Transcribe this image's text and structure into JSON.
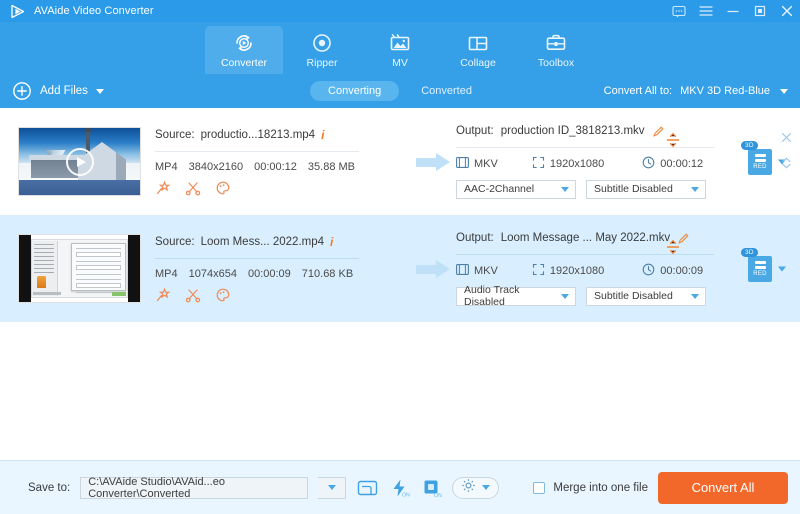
{
  "app": {
    "title": "AVAide Video Converter",
    "brand_color": "#2b9ae8",
    "accent_color": "#f2682a"
  },
  "titlebar": {
    "icons": [
      {
        "name": "feedback-icon",
        "glyph": "message"
      },
      {
        "name": "menu-icon",
        "glyph": "hamburger"
      },
      {
        "name": "minimize-icon",
        "glyph": "minimize"
      },
      {
        "name": "maximize-icon",
        "glyph": "maximize"
      },
      {
        "name": "close-icon",
        "glyph": "close"
      }
    ]
  },
  "nav": {
    "tabs": [
      {
        "label": "Converter",
        "icon": "converter-icon",
        "active": true
      },
      {
        "label": "Ripper",
        "icon": "ripper-icon",
        "active": false
      },
      {
        "label": "MV",
        "icon": "mv-icon",
        "active": false
      },
      {
        "label": "Collage",
        "icon": "collage-icon",
        "active": false
      },
      {
        "label": "Toolbox",
        "icon": "toolbox-icon",
        "active": false
      }
    ]
  },
  "toolbar": {
    "add_files_label": "Add Files",
    "segments": [
      {
        "label": "Converting",
        "active": true
      },
      {
        "label": "Converted",
        "active": false
      }
    ],
    "convert_all_to_label": "Convert All to:",
    "convert_all_to_value": "MKV 3D Red-Blue"
  },
  "list": {
    "rows": [
      {
        "source_prefix": "Source:",
        "source_name": "productio...18213.mp4",
        "format": "MP4",
        "resolution": "3840x2160",
        "duration": "00:00:12",
        "size": "35.88 MB",
        "output_prefix": "Output:",
        "output_name": "production ID_3818213.mkv",
        "out_format": "MKV",
        "out_resolution": "1920x1080",
        "out_duration": "00:00:12",
        "audio_track": "AAC-2Channel",
        "subtitle": "Subtitle Disabled",
        "badge_tag": "3D",
        "badge_text": "RED"
      },
      {
        "source_prefix": "Source:",
        "source_name": "Loom Mess... 2022.mp4",
        "format": "MP4",
        "resolution": "1074x654",
        "duration": "00:00:09",
        "size": "710.68 KB",
        "output_prefix": "Output:",
        "output_name": "Loom Message ... May 2022.mkv",
        "out_format": "MKV",
        "out_resolution": "1920x1080",
        "out_duration": "00:00:09",
        "audio_track": "Audio Track Disabled",
        "subtitle": "Subtitle Disabled",
        "badge_tag": "3D",
        "badge_text": "RED"
      }
    ]
  },
  "bottom": {
    "save_to_label": "Save to:",
    "save_to_path": "C:\\AVAide Studio\\AVAid...eo Converter\\Converted",
    "icons": [
      {
        "name": "open-folder-icon",
        "state": ""
      },
      {
        "name": "hardware-acceleration-icon",
        "state": "ON"
      },
      {
        "name": "gpu-acceleration-icon",
        "state": "ON"
      },
      {
        "name": "settings-gear-icon",
        "state": ""
      }
    ],
    "merge_label": "Merge into one file",
    "merge_checked": false,
    "convert_all_label": "Convert All"
  }
}
